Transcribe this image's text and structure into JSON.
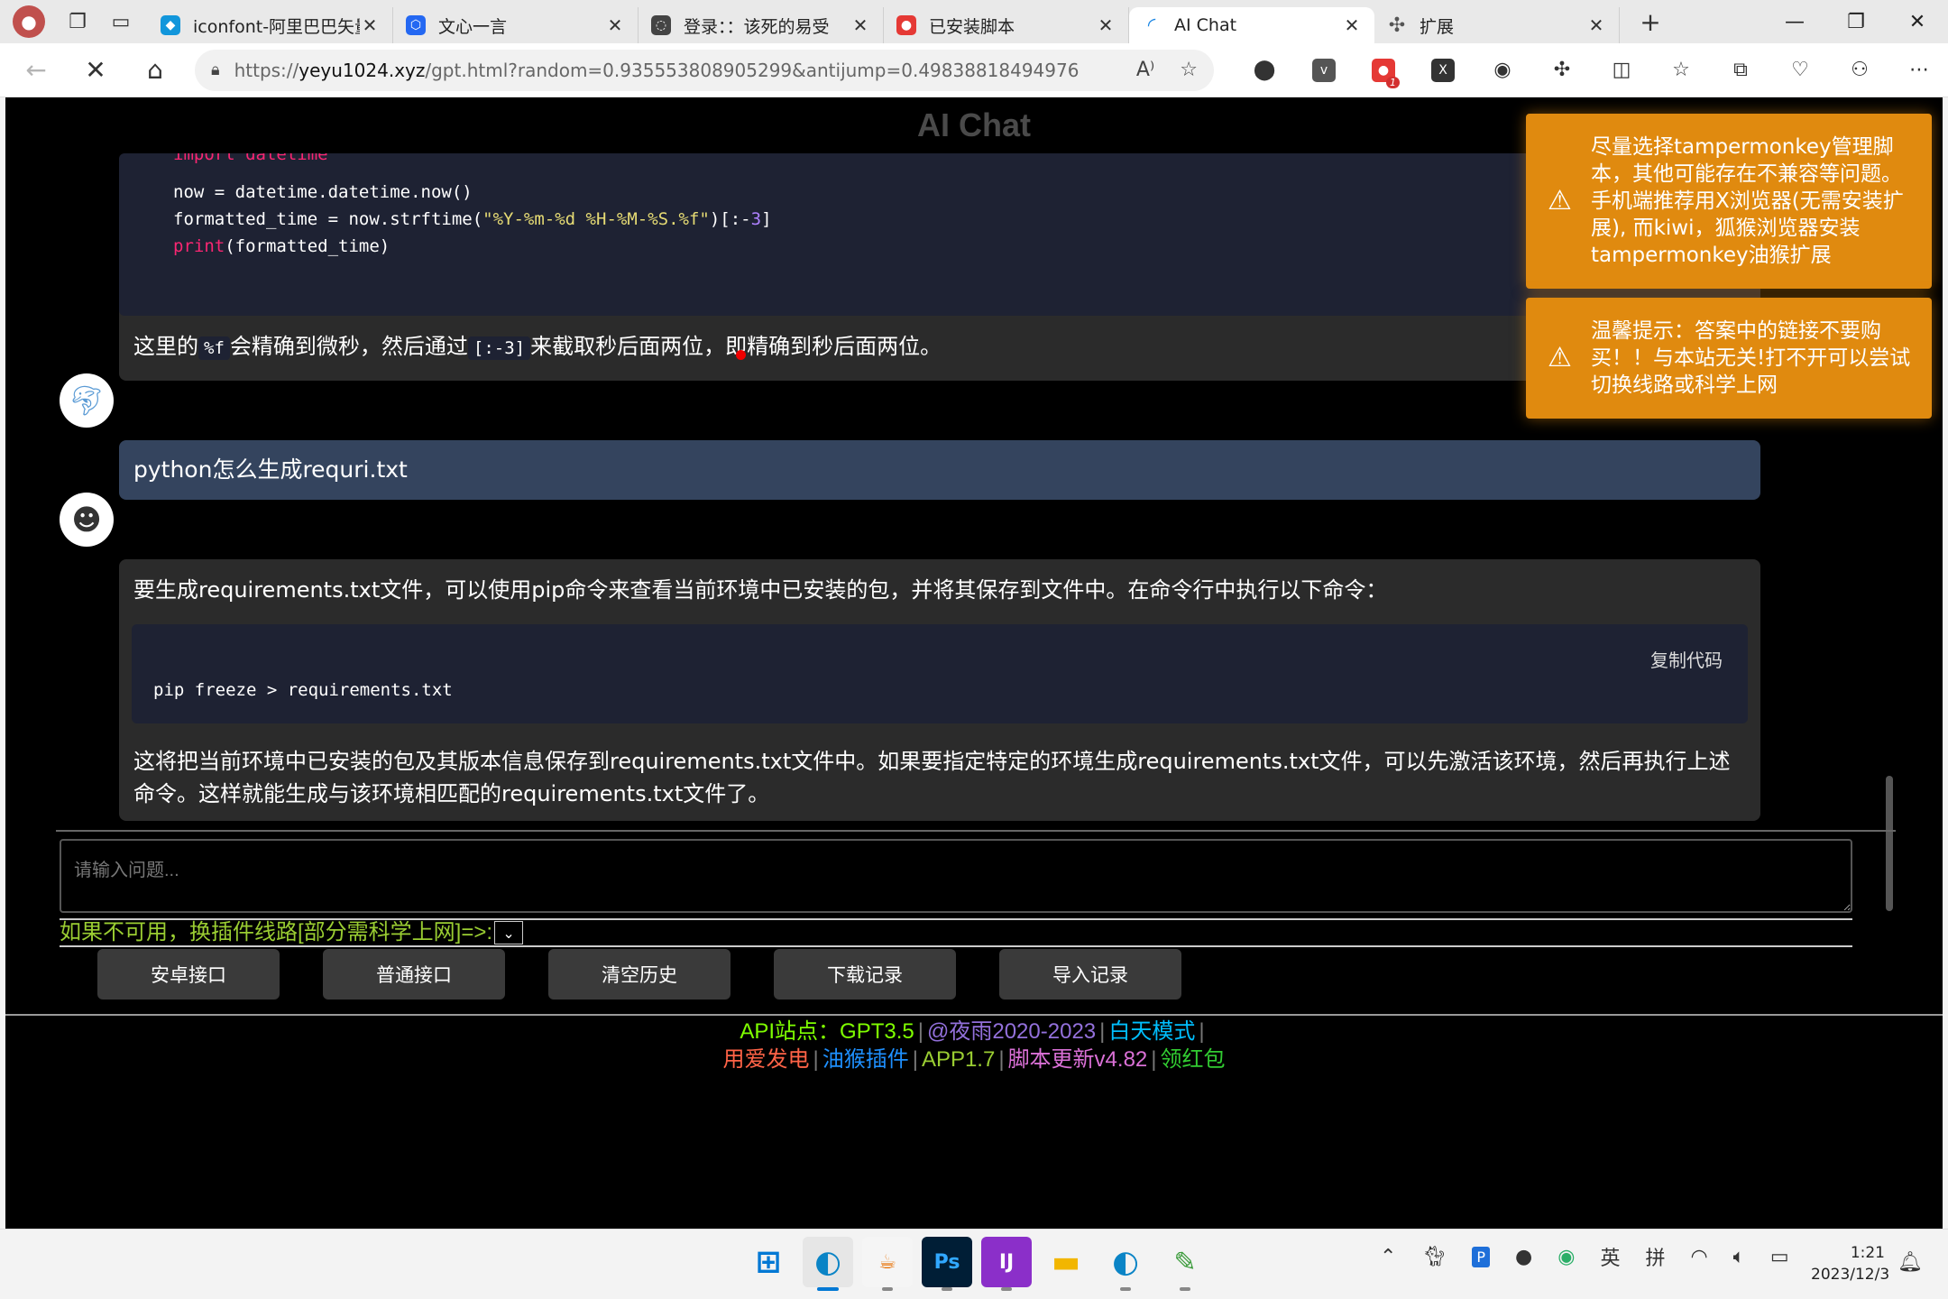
{
  "browser": {
    "tabs": [
      {
        "title": "iconfont-阿里巴巴矢量",
        "fav_color": "#1296db",
        "icon": "alibaba-icon"
      },
      {
        "title": "文心一言",
        "fav_color": "#2468f2",
        "icon": "wenxin-icon"
      },
      {
        "title": "登录：：该死的易受",
        "fav_color": "#444444",
        "icon": "login-icon"
      },
      {
        "title": "已安装脚本",
        "fav_color": "#e53935",
        "icon": "tampermonkey-icon"
      },
      {
        "title": "AI Chat",
        "fav_color": "#1e88e5",
        "icon": "loading-spinner-icon",
        "active": true
      },
      {
        "title": "扩展",
        "fav_color": "#555555",
        "icon": "puzzle-icon"
      }
    ],
    "url_prefix": "https://",
    "url_domain": "yeyu1024.xyz",
    "url_rest": "/gpt.html?random=0.935553808905299&antijump=0.49838818494976",
    "extension_badge": "1"
  },
  "page": {
    "title": "AI Chat",
    "chat": {
      "code_line_1_kw": "import",
      "code_line_1_rest": " datetime",
      "code_line_2": "now = datetime.datetime.now()",
      "code_line_3_a": "formatted_time = now.strftime(",
      "code_line_3_str": "\"%Y-%m-%d %H-%M-%S.%f\"",
      "code_line_3_b": ")[:-",
      "code_line_3_num": "3",
      "code_line_3_c": "]",
      "code_line_4_kw": "print",
      "code_line_4_rest": "(formatted_time)",
      "explain_a": "这里的",
      "explain_code1": "%f",
      "explain_b": "会精确到微秒，然后通过",
      "explain_code2": "[:-3]",
      "explain_c": "来截取秒后面两位，即精确到秒后面两位。",
      "user_question": "python怎么生成requri.txt",
      "answer_intro": "要生成requirements.txt文件，可以使用pip命令来查看当前环境中已安装的包，并将其保存到文件中。在命令行中执行以下命令：",
      "answer_code": "pip freeze > requirements.txt",
      "copy_code_label": "复制代码",
      "answer_outro": "这将把当前环境中已安装的包及其版本信息保存到requirements.txt文件中。如果要指定特定的环境生成requirements.txt文件，可以先激活该环境，然后再执行上述命令。这样就能生成与该环境相匹配的requirements.txt文件了。"
    },
    "input_placeholder": "请输入问题...",
    "route_label": "如果不可用，换插件线路[部分需科学上网]=>:",
    "buttons": [
      "安卓接口",
      "普通接口",
      "清空历史",
      "下载记录",
      "导入记录"
    ],
    "footer": {
      "api_site": "API站点：GPT3.5",
      "author": "@夜雨2020-2023",
      "day_mode": "白天模式",
      "power": "用爱发电",
      "plugin": "油猴插件",
      "app": "APP1.7",
      "script_update": "脚本更新v4.82",
      "red_packet": "领红包"
    },
    "toasts": [
      "尽量选择tampermonkey管理脚本，其他可能存在不兼容等问题。手机端推荐用X浏览器(无需安装扩展), 而kiwi，狐猴浏览器安装tampermonkey油猴扩展",
      "温馨提示：答案中的链接不要购买！！与本站无关!打不开可以尝试切换线路或科学上网"
    ]
  },
  "taskbar": {
    "time": "1:21",
    "date": "2023/12/3",
    "ime_lang": "英",
    "ime_mode": "拼"
  }
}
